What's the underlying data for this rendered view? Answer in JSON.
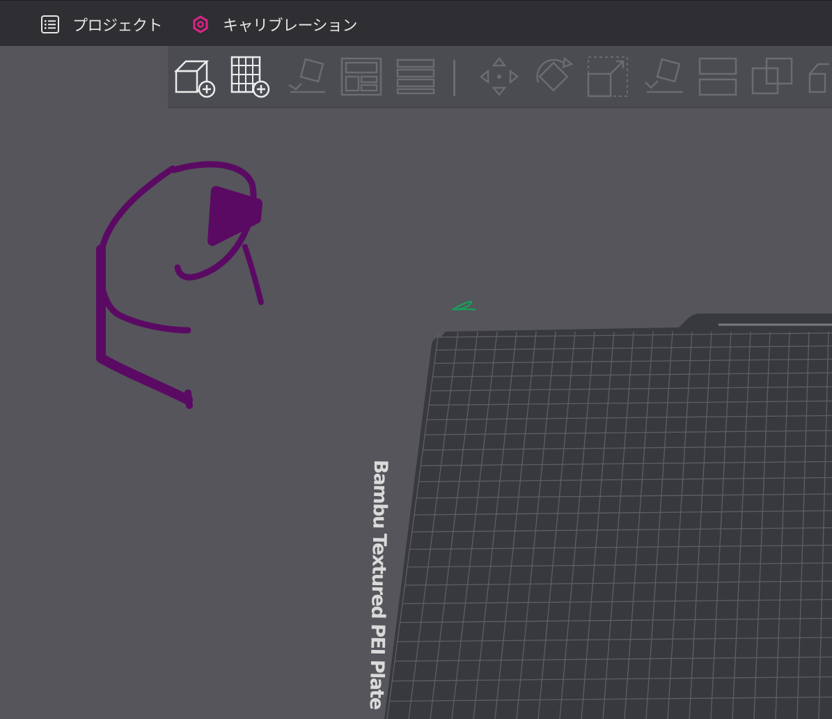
{
  "menu": {
    "project_label": "プロジェクト",
    "calibration_label": "キャリブレーション"
  },
  "toolbar": {
    "tools": [
      "add-object-icon",
      "add-plate-icon",
      "auto-orient-icon",
      "arrange-icon",
      "slice-layers-icon",
      "move-icon",
      "rotate-icon",
      "scale-icon",
      "lay-on-face-icon",
      "split-icon",
      "boolean-icon",
      "more-icon"
    ]
  },
  "plate": {
    "label": "Bambu Textured PEI Plate"
  },
  "colors": {
    "background": "#55555b",
    "topbar": "#2f2f33",
    "toolbar": "#4a4c52",
    "plate": "#38393e",
    "grid": "#5e5f65",
    "accent": "#e0218a",
    "annotation": "#5b0a63"
  }
}
